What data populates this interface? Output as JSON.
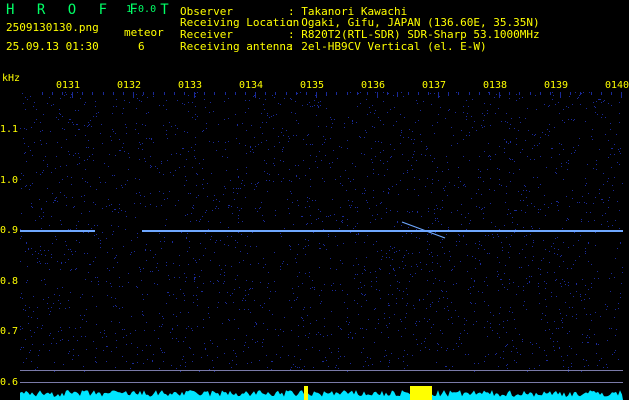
{
  "header": {
    "app_name": "H R O F F T",
    "version": "1.0.0",
    "filename": "2509130130.png",
    "datetime": "25.09.13 01:30",
    "event_label": "meteor",
    "event_count": "6",
    "fields": [
      {
        "label": "Observer",
        "value": ": Takanori Kawachi"
      },
      {
        "label": "Receiving Location",
        "value": ": Ogaki, Gifu, JAPAN (136.60E, 35.35N)"
      },
      {
        "label": "Receiver",
        "value": ": R820T2(RTL-SDR) SDR-Sharp 53.1000MHz"
      },
      {
        "label": "Receiving antenna",
        "value": ": 2el-HB9CV Vertical (el. E-W)"
      }
    ]
  },
  "chart_data": {
    "type": "heatmap",
    "ylabel": "kHz",
    "y_ticks": [
      "1.1",
      "1.0",
      "0.9",
      "0.8",
      "0.7",
      "0.6"
    ],
    "x_ticks": [
      "0131",
      "0132",
      "0133",
      "0134",
      "0135",
      "0136",
      "0137",
      "0138",
      "0139",
      "0140"
    ],
    "carrier_khz": 0.9,
    "colors": {
      "background": "#000000",
      "noise": "#1a2a9a",
      "signal": "#6fa8ff",
      "axis_text": "#ffff00",
      "level": "#00e5ff"
    }
  }
}
